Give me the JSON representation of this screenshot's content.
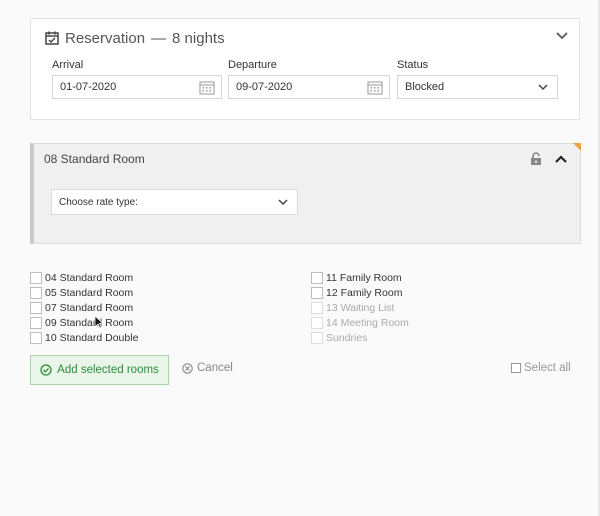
{
  "reservation": {
    "title": "Reservation",
    "separator": "—",
    "nights": "8 nights",
    "arrival": {
      "label": "Arrival",
      "value": "01-07-2020"
    },
    "departure": {
      "label": "Departure",
      "value": "09-07-2020"
    },
    "status": {
      "label": "Status",
      "value": "Blocked"
    }
  },
  "room": {
    "title": "08 Standard Room",
    "rate_placeholder": "Choose rate type:",
    "corner_color": "#f0a040"
  },
  "room_options": {
    "left": [
      {
        "label": "04 Standard Room",
        "disabled": false
      },
      {
        "label": "05 Standard Room",
        "disabled": false
      },
      {
        "label": "07 Standard Room",
        "disabled": false
      },
      {
        "label": "09 Standard Room",
        "disabled": false
      },
      {
        "label": "10 Standard Double",
        "disabled": false
      }
    ],
    "right": [
      {
        "label": "11 Family Room",
        "disabled": false
      },
      {
        "label": "12 Family Room",
        "disabled": false
      },
      {
        "label": "13 Waiting List",
        "disabled": true
      },
      {
        "label": "14 Meeting Room",
        "disabled": true
      },
      {
        "label": "Sundries",
        "disabled": true
      }
    ]
  },
  "actions": {
    "add_label": "Add selected rooms",
    "cancel_label": "Cancel",
    "select_all_label": "Select all"
  },
  "colors": {
    "accent_green": "#2e8b3a",
    "accent_orange": "#f0a040"
  }
}
